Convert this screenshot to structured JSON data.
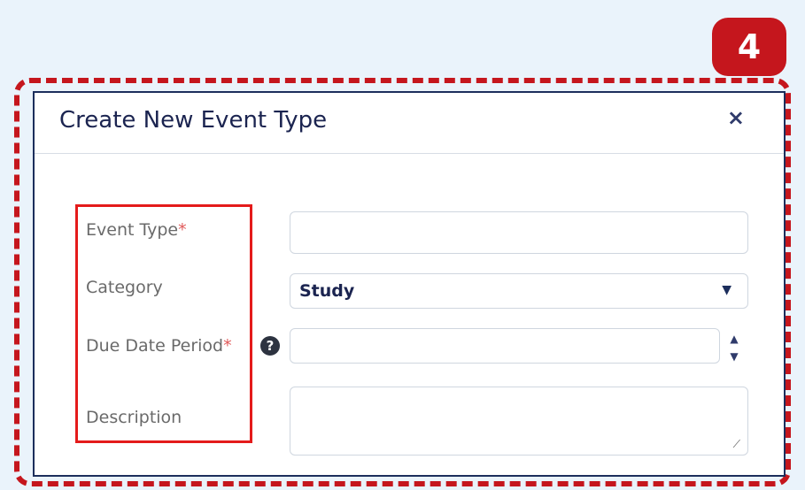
{
  "step_badge": "4",
  "dialog": {
    "title": "Create New Event Type",
    "close_icon": "×",
    "labels": {
      "event_type": "Event Type",
      "category": "Category",
      "due_date_period": "Due Date Period",
      "description": "Description",
      "required_mark": "*"
    },
    "fields": {
      "event_type_value": "",
      "category_value": "Study",
      "due_date_period_value": "",
      "description_value": ""
    },
    "icons": {
      "help": "help-icon",
      "close": "close-icon",
      "dropdown": "chevron-down-icon",
      "stepper": "number-stepper-icon"
    },
    "colors": {
      "accent": "#c5161d",
      "border": "#1c2e5c"
    }
  }
}
